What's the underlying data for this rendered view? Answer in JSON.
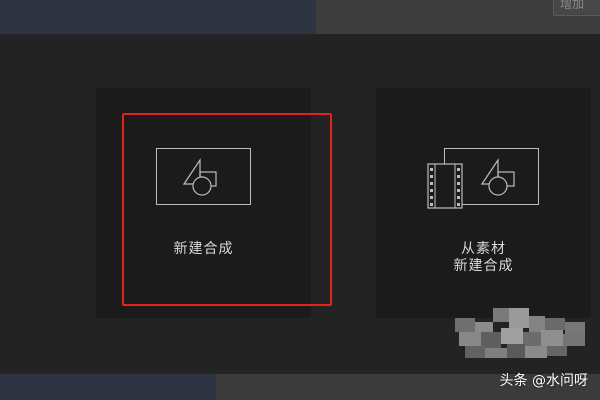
{
  "top_bar": {
    "button_label": "增加"
  },
  "panels": {
    "new_composition": {
      "label": "新建合成",
      "icon": "composition-shapes-icon"
    },
    "from_footage": {
      "label_line1": "从素材",
      "label_line2": "新建合成",
      "icon": "footage-composition-icon"
    }
  },
  "highlight": {
    "color": "#e0241b"
  },
  "watermark": {
    "text": "头条 @水问呀"
  },
  "colors": {
    "background": "#232323",
    "panel": "#1b1b1b",
    "icon_stroke": "#bdbdbd",
    "accent_strip": "#2e3441"
  }
}
